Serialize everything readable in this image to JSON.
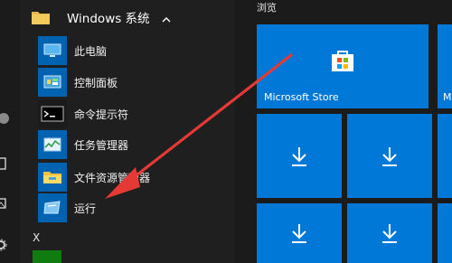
{
  "start_menu": {
    "group": {
      "label": "Windows 系统",
      "icon": "folder-icon",
      "expanded": true
    },
    "items": [
      {
        "label": "此电脑",
        "icon": "this-pc-icon"
      },
      {
        "label": "控制面板",
        "icon": "control-panel-icon"
      },
      {
        "label": "命令提示符",
        "icon": "command-prompt-icon"
      },
      {
        "label": "任务管理器",
        "icon": "task-manager-icon"
      },
      {
        "label": "文件资源管理器",
        "icon": "file-explorer-icon"
      },
      {
        "label": "运行",
        "icon": "run-icon"
      }
    ],
    "next_section_letter": "X"
  },
  "tiles": {
    "header": "浏览",
    "store_tile_label": "Microsoft Store",
    "partial_tile_label": "M",
    "download_tile_icon": "download-icon"
  },
  "colors": {
    "tile_blue": "#0078d7",
    "icon_blue": "#0063b1",
    "annotation_red": "#e53935",
    "background": "#1f1f1f"
  }
}
